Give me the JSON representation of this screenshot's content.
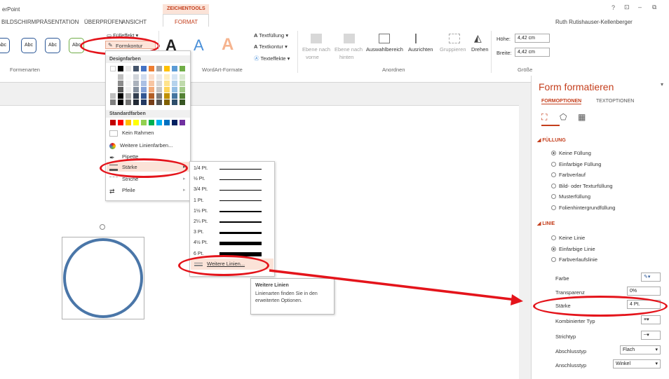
{
  "app": {
    "title_fragment": "erPoint",
    "user": "Ruth Rutishauser-Kellenberger",
    "window_controls": [
      "?",
      "□",
      "–",
      "🗗"
    ]
  },
  "tabs": {
    "slideshow": "BILDSCHIRMPRÄSENTATION",
    "review": "ÜBERPRÜFEN",
    "view": "ANSICHT",
    "context_group": "ZEICHENTOOLS",
    "format": "FORMAT"
  },
  "ribbon": {
    "shape_styles": {
      "label": "Formenarten",
      "abc": "Abc",
      "fill_effect": "Fülleffekt",
      "outline": "Formkontur"
    },
    "wordart": {
      "label": "WordArt-Formate",
      "text_fill": "Textfüllung",
      "text_outline": "Textkontur",
      "text_effects": "Texteffekte",
      "letter": "A"
    },
    "arrange": {
      "label": "Anordnen",
      "forward_a": "Ebene nach",
      "forward_b": "vorne",
      "backward_a": "Ebene nach",
      "backward_b": "hinten",
      "selection_pane": "Auswahlbereich",
      "align": "Ausrichten",
      "group": "Gruppieren",
      "rotate": "Drehen"
    },
    "size": {
      "label": "Größe",
      "height_label": "Höhe:",
      "height_value": "4,42 cm",
      "width_label": "Breite:",
      "width_value": "4,42 cm"
    }
  },
  "menu": {
    "theme_colors": "Designfarben",
    "standard_colors": "Standardfarben",
    "no_outline": "Kein Rahmen",
    "more_colors": "Weitere Linienfarben...",
    "eyedropper": "Pipette",
    "weight": "Stärke",
    "dashes": "Striche",
    "arrows": "Pfeile",
    "theme_row": [
      "#ffffff",
      "#000000",
      "#e7e6e6",
      "#44546a",
      "#4472c4",
      "#ed7d31",
      "#a5a5a5",
      "#ffc000",
      "#5b9bd5",
      "#70ad47"
    ],
    "standard_row": [
      "#c00000",
      "#ff0000",
      "#ffc000",
      "#ffff00",
      "#92d050",
      "#00b050",
      "#00b0f0",
      "#0070c0",
      "#002060",
      "#7030a0"
    ]
  },
  "submenu": {
    "weights": [
      "1/4 Pt.",
      "½ Pt.",
      "3/4 Pt.",
      "1 Pt.",
      "1½ Pt.",
      "2¼ Pt.",
      "3 Pt.",
      "4½ Pt.",
      "6 Pt."
    ],
    "more_lines": "Weitere Linien..."
  },
  "tooltip": {
    "title": "Weitere Linien",
    "body": "Linienarten finden Sie in den erweiterten Optionen."
  },
  "pane": {
    "title": "Form formatieren",
    "tab_shape": "FORMOPTIONEN",
    "tab_text": "TEXTOPTIONEN",
    "fill_section": "FÜLLUNG",
    "fill_options": [
      "Keine Füllung",
      "Einfarbige Füllung",
      "Farbverlauf",
      "Bild- oder Texturfüllung",
      "Musterfüllung",
      "Folienhintergrundfüllung"
    ],
    "line_section": "LINIE",
    "line_options": [
      "Keine Linie",
      "Einfarbige Linie",
      "Farbverlaufslinie"
    ],
    "color_label": "Farbe",
    "transparency_label": "Transparenz",
    "transparency_value": "0%",
    "width_label": "Stärke",
    "width_value": "4 Pt.",
    "compound_label": "Kombinierter Typ",
    "dash_label": "Strichtyp",
    "cap_label": "Abschlusstyp",
    "cap_value": "Flach",
    "join_label": "Anschlusstyp",
    "join_value": "Winkel"
  },
  "colors": {
    "accent": "#c43e1c",
    "shape_blue": "#4a76a8",
    "highlight_red": "#e4141b"
  }
}
